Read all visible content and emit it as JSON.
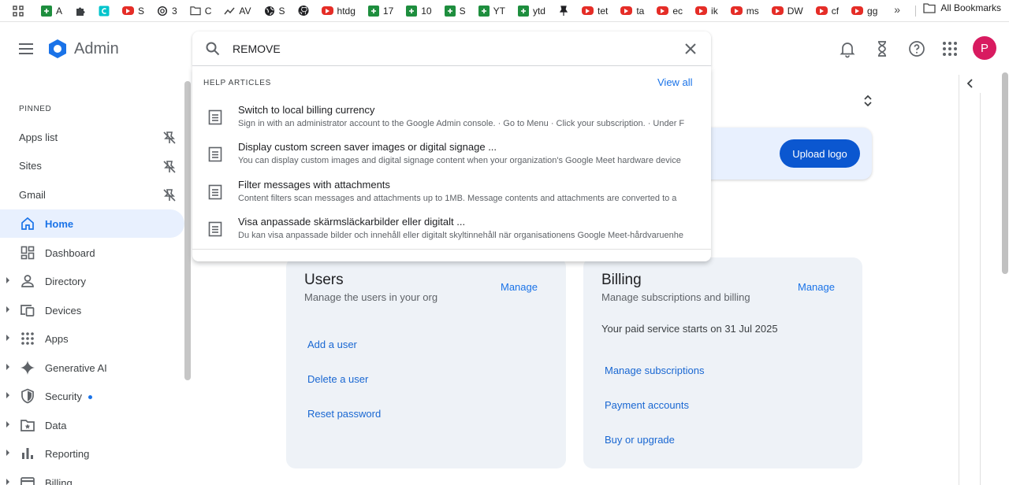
{
  "bookmarks": [
    {
      "icon": "sheets-icon",
      "label": "A"
    },
    {
      "icon": "puzzle-icon",
      "label": ""
    },
    {
      "icon": "canva-icon",
      "label": ""
    },
    {
      "icon": "youtube-icon",
      "label": "S"
    },
    {
      "icon": "openai-icon",
      "label": "3"
    },
    {
      "icon": "folder-icon",
      "label": "C"
    },
    {
      "icon": "trend-icon",
      "label": "AV"
    },
    {
      "icon": "globe-icon",
      "label": "S"
    },
    {
      "icon": "github-icon",
      "label": ""
    },
    {
      "icon": "youtube-icon",
      "label": "htdg"
    },
    {
      "icon": "sheets-icon",
      "label": "17"
    },
    {
      "icon": "sheets-icon",
      "label": "10"
    },
    {
      "icon": "sheets-icon",
      "label": "S"
    },
    {
      "icon": "sheets-icon",
      "label": "YT"
    },
    {
      "icon": "sheets-icon",
      "label": "ytd"
    },
    {
      "icon": "pin-icon",
      "label": ""
    },
    {
      "icon": "youtube-icon",
      "label": "tet"
    },
    {
      "icon": "youtube-icon",
      "label": "ta"
    },
    {
      "icon": "youtube-icon",
      "label": "ec"
    },
    {
      "icon": "youtube-icon",
      "label": "ik"
    },
    {
      "icon": "youtube-icon",
      "label": "ms"
    },
    {
      "icon": "youtube-icon",
      "label": "DW"
    },
    {
      "icon": "youtube-icon",
      "label": "cf"
    },
    {
      "icon": "youtube-icon",
      "label": "gg"
    }
  ],
  "bookmarks_all": "All Bookmarks",
  "header": {
    "app_name": "Admin",
    "avatar_letter": "P"
  },
  "search": {
    "value": "REMOVE",
    "section_label": "HELP ARTICLES",
    "view_all": "View all",
    "articles": [
      {
        "title": "Switch to local billing currency",
        "desc": "Sign in with an administrator account to the Google Admin console. · Go to Menu · Click your subscription. · Under F"
      },
      {
        "title": "Display custom screen saver images or digital signage ...",
        "desc": "You can display custom images and digital signage content when your organization's Google Meet hardware device"
      },
      {
        "title": "Filter messages with attachments",
        "desc": "Content filters scan messages and attachments up to 1MB. Message contents and attachments are converted to a"
      },
      {
        "title": "Visa anpassade skärmsläckarbilder eller digitalt ...",
        "desc": "Du kan visa anpassade bilder och innehåll eller digitalt skyltinnehåll när organisationens Google Meet-hårdvaruenhe"
      }
    ]
  },
  "sidebar": {
    "pinned_label": "PINNED",
    "pinned": [
      "Apps list",
      "Sites",
      "Gmail"
    ],
    "nav": [
      {
        "label": "Home",
        "icon": "home-icon",
        "active": true,
        "expandable": false
      },
      {
        "label": "Dashboard",
        "icon": "dashboard-icon",
        "active": false,
        "expandable": false
      },
      {
        "label": "Directory",
        "icon": "person-icon",
        "active": false,
        "expandable": true
      },
      {
        "label": "Devices",
        "icon": "devices-icon",
        "active": false,
        "expandable": true
      },
      {
        "label": "Apps",
        "icon": "apps-grid-icon",
        "active": false,
        "expandable": true
      },
      {
        "label": "Generative AI",
        "icon": "sparkle-icon",
        "active": false,
        "expandable": true
      },
      {
        "label": "Security",
        "icon": "shield-icon",
        "active": false,
        "expandable": true,
        "dot": true
      },
      {
        "label": "Data",
        "icon": "data-folder-icon",
        "active": false,
        "expandable": true
      },
      {
        "label": "Reporting",
        "icon": "bar-chart-icon",
        "active": false,
        "expandable": true
      },
      {
        "label": "Billing",
        "icon": "billing-icon",
        "active": false,
        "expandable": true
      }
    ]
  },
  "promo": {
    "upload_label": "Upload logo"
  },
  "cards": {
    "users": {
      "title": "Users",
      "subtitle": "Manage the users in your org",
      "manage": "Manage",
      "links": [
        "Add a user",
        "Delete a user",
        "Reset password"
      ]
    },
    "billing": {
      "title": "Billing",
      "subtitle": "Manage subscriptions and billing",
      "manage": "Manage",
      "status": "Your paid service starts on 31 Jul 2025",
      "links": [
        "Manage subscriptions",
        "Payment accounts",
        "Buy or upgrade"
      ]
    }
  },
  "colors": {
    "accent": "#1a73e8",
    "avatar": "#d81b60",
    "upload_button": "#0b57d0",
    "card_bg": "#eef2f7"
  }
}
